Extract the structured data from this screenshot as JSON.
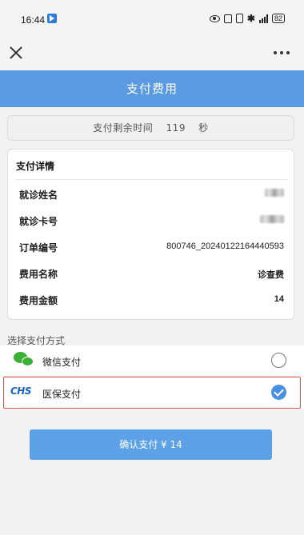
{
  "status_bar": {
    "time": "16:44",
    "battery": "82"
  },
  "nav": {
    "close_icon": "close-icon",
    "more_icon": "more-icon"
  },
  "header": {
    "title": "支付费用"
  },
  "countdown": {
    "label": "支付剩余时间",
    "seconds": "119",
    "unit": "秒"
  },
  "details": {
    "title": "支付详情",
    "rows": [
      {
        "label": "就诊姓名",
        "value": ""
      },
      {
        "label": "就诊卡号",
        "value": ""
      },
      {
        "label": "订单编号",
        "value": "800746_20240122164440593"
      },
      {
        "label": "费用名称",
        "value": "诊查费"
      },
      {
        "label": "费用金额",
        "value": "14"
      }
    ]
  },
  "payment": {
    "section_label": "选择支付方式",
    "methods": [
      {
        "name": "微信支付",
        "icon": "wechat-icon",
        "selected": false
      },
      {
        "name": "医保支付",
        "icon": "chs-logo-icon",
        "icon_text": "CHS",
        "selected": true
      }
    ]
  },
  "confirm_button": {
    "label": "确认支付 ¥ 14"
  },
  "colors": {
    "header_bg": "#5a9ae0",
    "button_bg": "#5ca0e6",
    "wechat_green": "#3cb035",
    "chs_blue": "#1565c0",
    "highlight_red": "#d9534f",
    "radio_checked": "#4a90e2"
  }
}
